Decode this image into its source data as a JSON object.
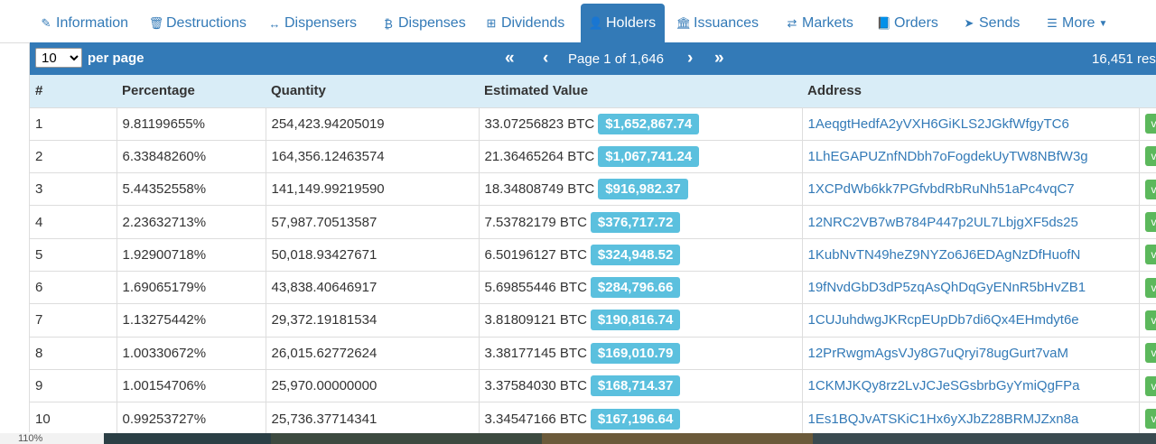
{
  "tabs": [
    {
      "label": "Information",
      "icon": "pencil-icon",
      "glyph": "✎"
    },
    {
      "label": "Destructions",
      "icon": "trash-icon",
      "glyph": "🗑"
    },
    {
      "label": "Dispensers",
      "icon": "arrows-h-icon",
      "glyph": "↔"
    },
    {
      "label": "Dispenses",
      "icon": "bitcoin-icon",
      "glyph": "₿"
    },
    {
      "label": "Dividends",
      "icon": "sitemap-icon",
      "glyph": "⊞"
    },
    {
      "label": "Holders",
      "icon": "user-icon",
      "glyph": "👤"
    },
    {
      "label": "Issuances",
      "icon": "bank-icon",
      "glyph": "🏛"
    },
    {
      "label": "Markets",
      "icon": "exchange-icon",
      "glyph": "⇄"
    },
    {
      "label": "Orders",
      "icon": "book-icon",
      "glyph": "📘"
    },
    {
      "label": "Sends",
      "icon": "send-icon",
      "glyph": "➤"
    },
    {
      "label": "More",
      "icon": "list-icon",
      "glyph": "☰"
    }
  ],
  "active_tab": "Holders",
  "pager": {
    "per_page_value": "10",
    "per_page_label": "per page",
    "first_glyph": "«",
    "prev_glyph": "‹",
    "page_info": "Page 1 of 1,646",
    "next_glyph": "›",
    "last_glyph": "»",
    "results": "16,451 res"
  },
  "columns": [
    "#",
    "Percentage",
    "Quantity",
    "Estimated Value",
    "Address"
  ],
  "rows": [
    {
      "n": "1",
      "pct": "9.81199655%",
      "qty": "254,423.94205019",
      "btc": "33.07256823 BTC",
      "usd": "$1,652,867.74",
      "addr": "1AeqgtHedfA2yVXH6GiKLS2JGkfWfgyTC6",
      "v": "v"
    },
    {
      "n": "2",
      "pct": "6.33848260%",
      "qty": "164,356.12463574",
      "btc": "21.36465264 BTC",
      "usd": "$1,067,741.24",
      "addr": "1LhEGAPUZnfNDbh7oFogdekUyTW8NBfW3g",
      "v": "v"
    },
    {
      "n": "3",
      "pct": "5.44352558%",
      "qty": "141,149.99219590",
      "btc": "18.34808749 BTC",
      "usd": "$916,982.37",
      "addr": "1XCPdWb6kk7PGfvbdRbRuNh51aPc4vqC7",
      "v": "v"
    },
    {
      "n": "4",
      "pct": "2.23632713%",
      "qty": "57,987.70513587",
      "btc": "7.53782179 BTC",
      "usd": "$376,717.72",
      "addr": "12NRC2VB7wB784P447p2UL7LbjgXF5ds25",
      "v": "v"
    },
    {
      "n": "5",
      "pct": "1.92900718%",
      "qty": "50,018.93427671",
      "btc": "6.50196127 BTC",
      "usd": "$324,948.52",
      "addr": "1KubNvTN49heZ9NYZo6J6EDAgNzDfHuofN",
      "v": "v"
    },
    {
      "n": "6",
      "pct": "1.69065179%",
      "qty": "43,838.40646917",
      "btc": "5.69855446 BTC",
      "usd": "$284,796.66",
      "addr": "19fNvdGbD3dP5zqAsQhDqGyENnR5bHvZB1",
      "v": "v"
    },
    {
      "n": "7",
      "pct": "1.13275442%",
      "qty": "29,372.19181534",
      "btc": "3.81809121 BTC",
      "usd": "$190,816.74",
      "addr": "1CUJuhdwgJKRcpEUpDb7di6Qx4EHmdyt6e",
      "v": "v"
    },
    {
      "n": "8",
      "pct": "1.00330672%",
      "qty": "26,015.62772624",
      "btc": "3.38177145 BTC",
      "usd": "$169,010.79",
      "addr": "12PrRwgmAgsVJy8G7uQryi78ugGurt7vaM",
      "v": "v"
    },
    {
      "n": "9",
      "pct": "1.00154706%",
      "qty": "25,970.00000000",
      "btc": "3.37584030 BTC",
      "usd": "$168,714.37",
      "addr": "1CKMJKQy8rz2LvJCJeSGsbrbGyYmiQgFPa",
      "v": "v"
    },
    {
      "n": "10",
      "pct": "0.99253727%",
      "qty": "25,736.37714341",
      "btc": "3.34547166 BTC",
      "usd": "$167,196.64",
      "addr": "1Es1BQJvATSKiC1Hx6yXJbZ28BRMJZxn8a",
      "v": "v"
    }
  ],
  "zoom_text": "110%",
  "colors": {
    "primary": "#337ab7",
    "header_bg": "#d9edf7",
    "usd_badge": "#5bc0de",
    "view_button": "#5cb85c"
  }
}
